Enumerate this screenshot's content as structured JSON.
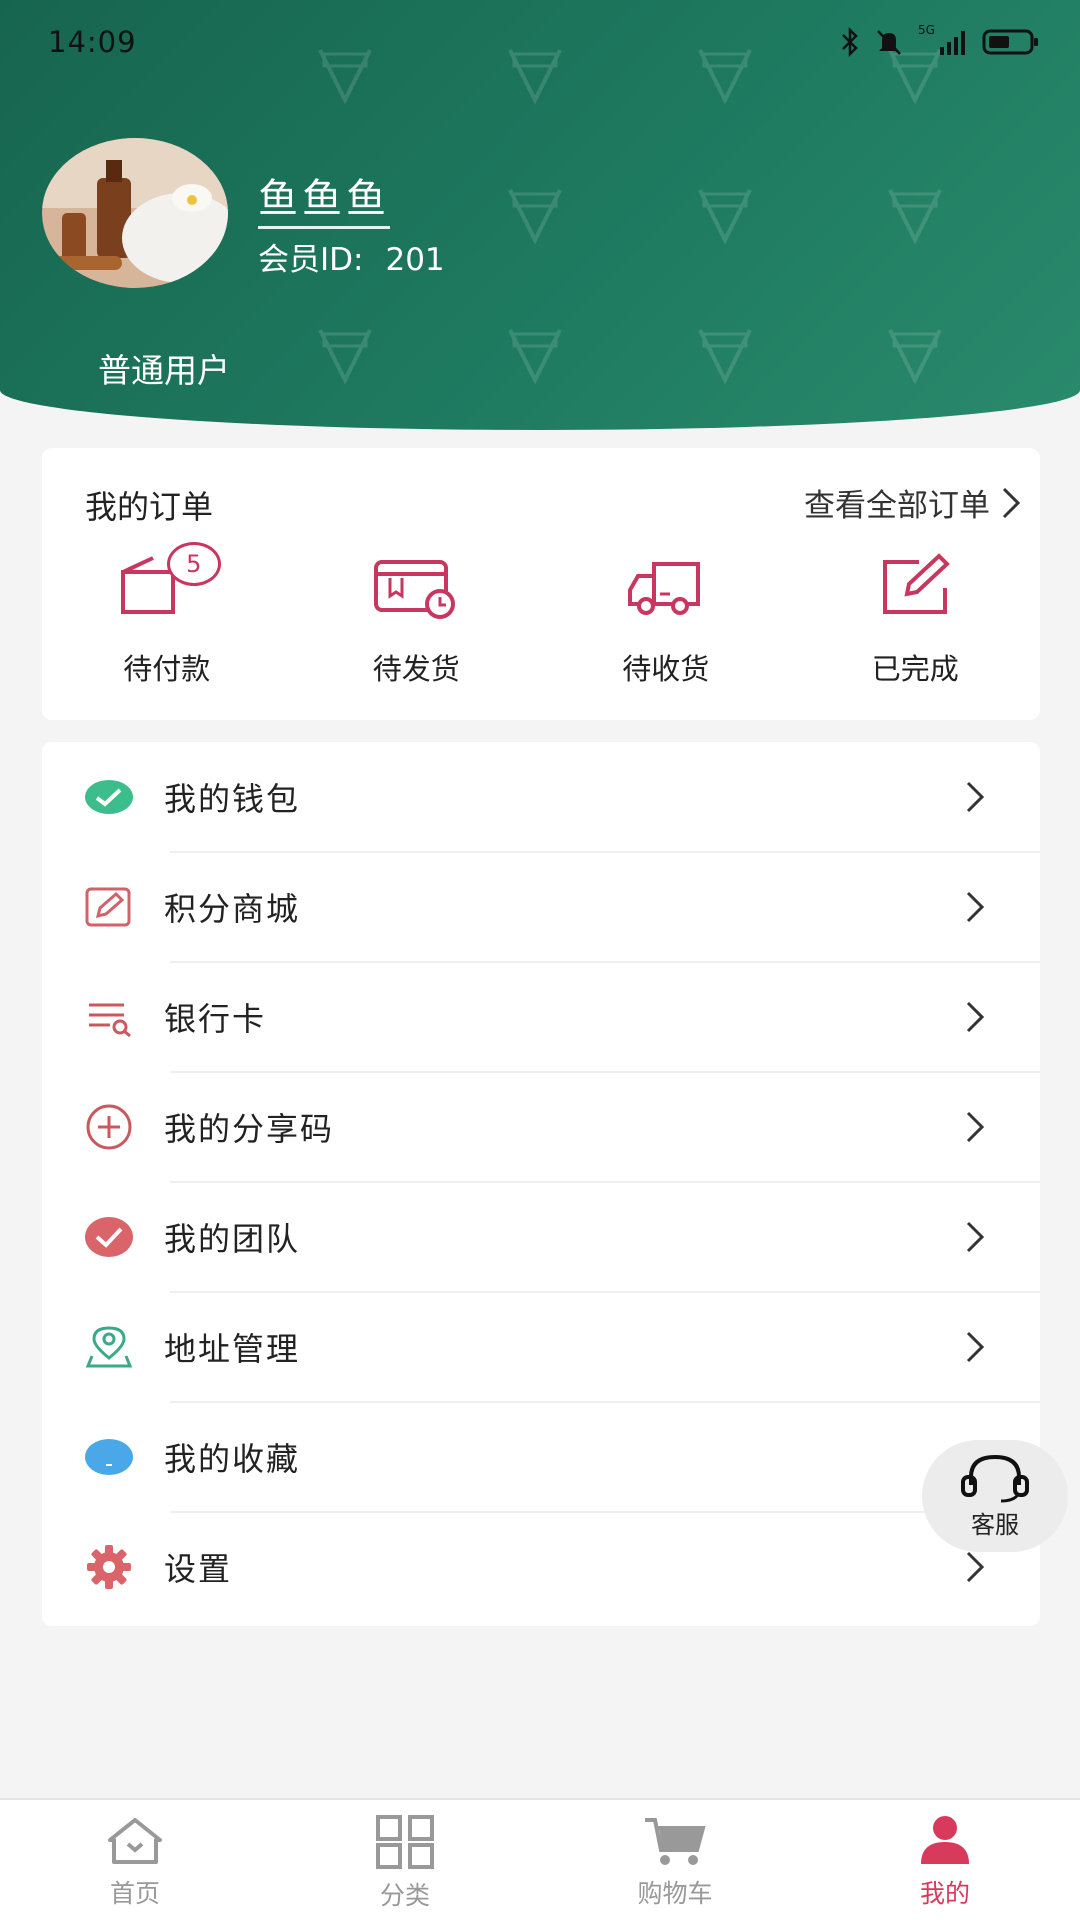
{
  "status_bar": {
    "time": "14:09",
    "network": "5G"
  },
  "profile": {
    "username": "鱼鱼鱼",
    "member_id_label": "会员ID:",
    "member_id": "201",
    "user_type": "普通用户"
  },
  "orders": {
    "title": "我的订单",
    "view_all": "查看全部订单",
    "items": [
      {
        "label": "待付款",
        "icon": "wallet-icon",
        "badge": "5"
      },
      {
        "label": "待发货",
        "icon": "package-clock-icon"
      },
      {
        "label": "待收货",
        "icon": "truck-icon"
      },
      {
        "label": "已完成",
        "icon": "edit-check-icon"
      }
    ]
  },
  "menu": {
    "items": [
      {
        "label": "我的钱包",
        "icon": "wallet-green-icon",
        "color": "#3dbd8c"
      },
      {
        "label": "积分商城",
        "icon": "pencil-square-icon",
        "color": "#d0626a"
      },
      {
        "label": "银行卡",
        "icon": "list-search-icon",
        "color": "#c85a5f"
      },
      {
        "label": "我的分享码",
        "icon": "plus-circle-icon",
        "color": "#c85a5f"
      },
      {
        "label": "我的团队",
        "icon": "check-circle-icon",
        "color": "#d9656b"
      },
      {
        "label": "地址管理",
        "icon": "location-icon",
        "color": "#3aa985"
      },
      {
        "label": "我的收藏",
        "icon": "favorite-blob-icon",
        "color": "#4aa8e8"
      },
      {
        "label": "设置",
        "icon": "gear-icon",
        "color": "#d9656b"
      }
    ]
  },
  "service": {
    "label": "客服"
  },
  "tabbar": {
    "items": [
      {
        "label": "首页",
        "icon": "home-icon"
      },
      {
        "label": "分类",
        "icon": "grid-icon"
      },
      {
        "label": "购物车",
        "icon": "cart-icon"
      },
      {
        "label": "我的",
        "icon": "person-icon",
        "active": true
      }
    ]
  },
  "colors": {
    "header": "#1e7a5f",
    "accent": "#c8375f",
    "active_tab": "#d83a5c"
  }
}
